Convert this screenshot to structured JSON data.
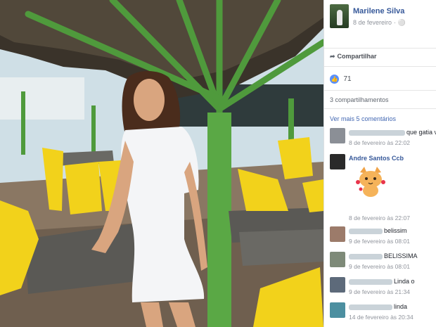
{
  "post": {
    "author": "Marilene Silva",
    "date": "8 de fevereiro",
    "privacy_icon": "globe-icon"
  },
  "actions": {
    "share_label": "Compartilhar",
    "share_icon": "share-arrow-icon"
  },
  "reactions": {
    "like_icon": "thumbs-up-icon",
    "like_count": "71",
    "shares_text": "3 compartilhamentos"
  },
  "comments_section": {
    "more_label": "Ver mais 5 comentários",
    "items": [
      {
        "name": "",
        "text": "que gatia vc e",
        "time": "8 de fevereiro às 22:02"
      },
      {
        "name": "Andre Santos Ccb",
        "text": "",
        "time": "8 de fevereiro às 22:07",
        "sticker": "cat-sticker"
      },
      {
        "name": "",
        "text": "belissim",
        "time": "9 de fevereiro às 08:01"
      },
      {
        "name": "",
        "text": "BELISSIMA",
        "time": "9 de fevereiro às 08:01"
      },
      {
        "name": "",
        "text": "Linda o",
        "time": "9 de fevereiro às 21:34"
      },
      {
        "name": "",
        "text": "linda",
        "time": "14 de fevereiro às 20:34"
      }
    ]
  },
  "colors": {
    "link_blue": "#365899",
    "like_blue": "#5890ff",
    "meta_gray": "#90949c",
    "kiosk_green": "#4f9a3c",
    "chair_yellow": "#f2d21b"
  }
}
